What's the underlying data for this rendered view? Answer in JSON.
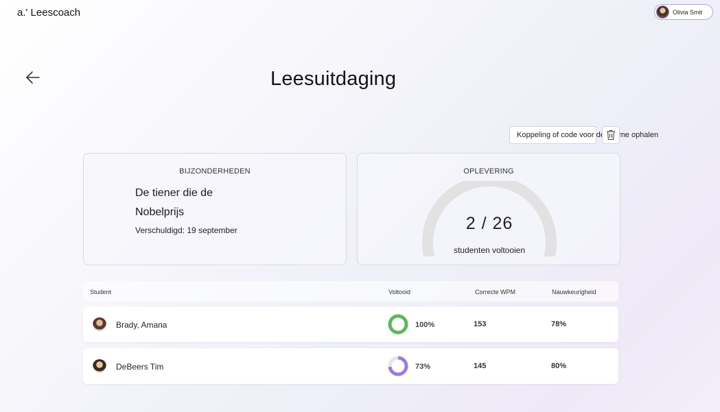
{
  "app": {
    "title": "a.' Leescoach"
  },
  "user": {
    "name": "Olivia Smit"
  },
  "page": {
    "title": "Leesuitdaging"
  },
  "actions": {
    "link_label": "Koppeling of code voor deelname ophalen",
    "delete_icon": "trash-icon"
  },
  "details": {
    "heading": "BIJZONDERHEDEN",
    "book_title_line1": "De tiener die de",
    "book_title_line2": "Nobelprijs",
    "due": "Verschuldigd: 19 september"
  },
  "submission": {
    "heading": "OPLEVERING",
    "completed": 2,
    "total": 26,
    "value_text": "2 / 26",
    "label": "studenten voltooien",
    "track_color": "#e2e2e2",
    "fill_color": "#3a8ee6"
  },
  "table": {
    "columns": [
      "Student",
      "Voltooid",
      "Correcte WPM",
      "Nauwkeurigheid"
    ],
    "rows": [
      {
        "name": "Brady, Amana",
        "completed": "100%",
        "completed_fraction": 1.0,
        "wpm": "153",
        "accuracy": "78%",
        "ring_color": "#5cb85c"
      },
      {
        "name": "DeBeers Tim",
        "completed": "73%",
        "completed_fraction": 0.73,
        "wpm": "145",
        "accuracy": "80%",
        "ring_color": "#9b7ddb"
      }
    ]
  }
}
